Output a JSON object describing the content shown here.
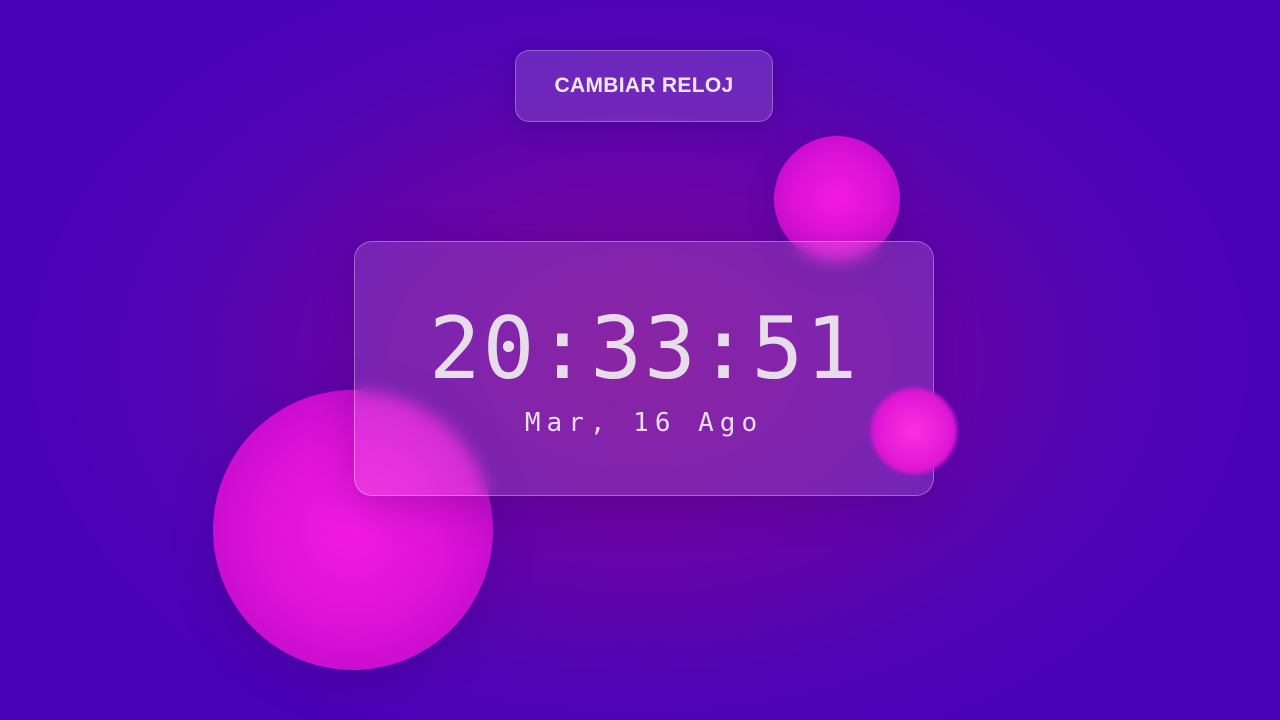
{
  "toggle_button": {
    "label": "CAMBIAR RELOJ"
  },
  "clock": {
    "time": "20:33:51",
    "date": "Mar, 16 Ago"
  },
  "colors": {
    "background_center": "#7a0496",
    "background_edge": "#4a02b8",
    "orb": "#e012d8",
    "text": "#e6dcea"
  }
}
